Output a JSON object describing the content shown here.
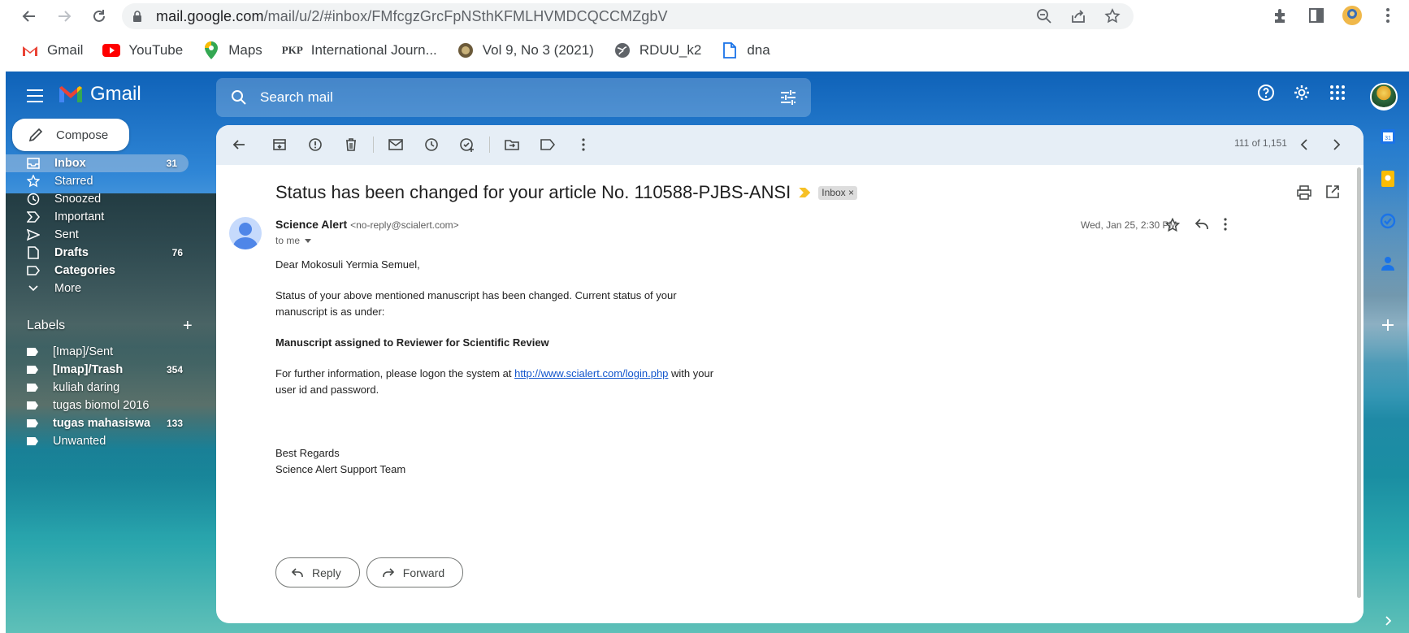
{
  "browser": {
    "url_host": "mail.google.com",
    "url_path": "/mail/u/2/#inbox/FMfcgzGrcFpNSthKFMLHVMDCQCCMZgbV",
    "bookmarks": [
      {
        "label": "Gmail",
        "icon": "gmail-icon"
      },
      {
        "label": "YouTube",
        "icon": "youtube-icon"
      },
      {
        "label": "Maps",
        "icon": "maps-icon"
      },
      {
        "label": "International Journ...",
        "icon": "pkp-icon",
        "prefix": "PKP"
      },
      {
        "label": "Vol 9, No 3 (2021)",
        "icon": "journal-icon"
      },
      {
        "label": "RDUU_k2",
        "icon": "globe-icon"
      },
      {
        "label": "dna",
        "icon": "file-icon"
      }
    ]
  },
  "gmail": {
    "logo_text": "Gmail",
    "search_placeholder": "Search mail",
    "compose_label": "Compose",
    "nav": [
      {
        "label": "Inbox",
        "count": "31",
        "icon": "inbox-icon"
      },
      {
        "label": "Starred",
        "count": "",
        "icon": "star-icon"
      },
      {
        "label": "Snoozed",
        "count": "",
        "icon": "clock-icon"
      },
      {
        "label": "Important",
        "count": "",
        "icon": "important-icon"
      },
      {
        "label": "Sent",
        "count": "",
        "icon": "send-icon"
      },
      {
        "label": "Drafts",
        "count": "76",
        "icon": "draft-icon"
      },
      {
        "label": "Categories",
        "count": "",
        "icon": "label-icon"
      },
      {
        "label": "More",
        "count": "",
        "icon": "chevron-down-icon"
      }
    ],
    "labels_heading": "Labels",
    "labels": [
      {
        "label": "[Imap]/Sent",
        "count": ""
      },
      {
        "label": "[Imap]/Trash",
        "count": "354"
      },
      {
        "label": "kuliah daring",
        "count": ""
      },
      {
        "label": "tugas biomol 2016",
        "count": ""
      },
      {
        "label": "tugas mahasiswa",
        "count": "133"
      },
      {
        "label": "Unwanted",
        "count": ""
      }
    ],
    "pager": "111 of 1,151"
  },
  "email": {
    "subject": "Status has been changed for your article No. 110588-PJBS-ANSI",
    "chip": "Inbox",
    "chip_close": "×",
    "sender_name": "Science Alert",
    "sender_addr": "<no-reply@scialert.com>",
    "to": "to me",
    "date": "Wed, Jan 25, 2:30 PM",
    "greeting": "Dear Mokosuli Yermia Semuel,",
    "para1": "Status of your above mentioned manuscript has been changed. Current status of your manuscript is as under:",
    "status": "Manuscript assigned to Reviewer for Scientific Review",
    "para3_before": "For further information, please logon the system at ",
    "link": "http://www.scialert.com/login.php",
    "para3_after": " with your user id and password.",
    "regards": "Best Regards",
    "team": "Science Alert Support Team",
    "reply_label": "Reply",
    "forward_label": "Forward"
  },
  "colors": {
    "accent": "#0b57d0",
    "link": "#1155cc",
    "important": "#f6c026"
  }
}
